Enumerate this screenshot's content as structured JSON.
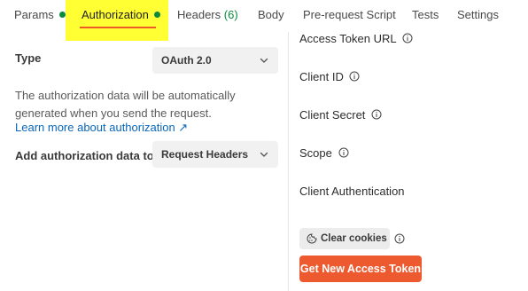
{
  "tabs": {
    "params": "Params",
    "authorization": "Authorization",
    "headers": "Headers",
    "headers_count": "(6)",
    "body": "Body",
    "prerequest": "Pre-request Script",
    "tests": "Tests",
    "settings": "Settings"
  },
  "auth": {
    "type_label": "Type",
    "type_value": "OAuth 2.0",
    "description": "The authorization data will be automatically generated when you send the request.",
    "learn_more": "Learn more about authorization ↗",
    "add_to_label": "Add authorization data to",
    "add_to_value": "Request Headers"
  },
  "config": {
    "access_token_url": "Access Token URL",
    "client_id": "Client ID",
    "client_secret": "Client Secret",
    "scope": "Scope",
    "client_authentication": "Client Authentication",
    "clear_cookies": "Clear cookies",
    "get_new_token": "Get New Access Token"
  },
  "colors": {
    "accent": "#ee5a2f",
    "highlight": "#ffff33",
    "success_dot": "#0b8a3e",
    "link": "#0a66b8"
  },
  "icons": {
    "info": "info-icon",
    "chevron": "chevron-down-icon",
    "cookie": "cookie-icon",
    "external": "external-link-icon"
  }
}
